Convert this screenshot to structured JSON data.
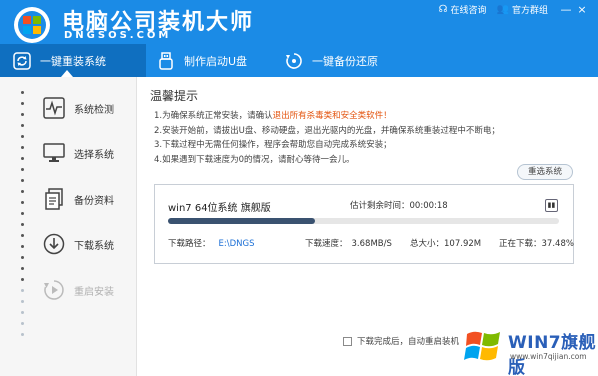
{
  "brand": {
    "title": "电脑公司装机大师",
    "subtitle": "DNGSOS.COM"
  },
  "top_links": {
    "consult": "在线咨询",
    "official_group": "官方群组",
    "minimize": "—",
    "close": "×"
  },
  "tabs": [
    {
      "label": "一键重装系统",
      "icon": "refresh-icon",
      "active": true
    },
    {
      "label": "制作启动U盘",
      "icon": "usb-icon",
      "active": false
    },
    {
      "label": "一键备份还原",
      "icon": "restore-icon",
      "active": false
    }
  ],
  "sidebar": {
    "items": [
      {
        "label": "系统检测",
        "icon": "pulse-icon",
        "enabled": true
      },
      {
        "label": "选择系统",
        "icon": "monitor-icon",
        "enabled": true
      },
      {
        "label": "备份资料",
        "icon": "documents-icon",
        "enabled": true
      },
      {
        "label": "下载系统",
        "icon": "download-icon",
        "enabled": true
      },
      {
        "label": "重启安装",
        "icon": "reboot-icon",
        "enabled": false
      }
    ]
  },
  "notice": {
    "title": "温馨提示",
    "tips": [
      {
        "prefix": "1.为确保系统正常安装，请确认",
        "warn": "退出所有杀毒类和安全类软件！",
        "suffix": ""
      },
      {
        "prefix": "2.安装开始前，请拔出U盘、移动硬盘，退出光驱内的光盘，并确保系统重装过程中不断电；",
        "warn": "",
        "suffix": ""
      },
      {
        "prefix": "3.下载过程中无需任何操作，程序会帮助您自动完成系统安装；",
        "warn": "",
        "suffix": ""
      },
      {
        "prefix": "4.如果遇到下载速度为0的情况，请耐心等待一会儿。",
        "warn": "",
        "suffix": ""
      }
    ]
  },
  "reselect_button": "重选系统",
  "download": {
    "system_name": "win7 64位系统 旗舰版",
    "remaining_label": "估计剩余时间：",
    "remaining_value": "00:00:18",
    "pause_icon": "pause-icon",
    "progress": 0.3748,
    "path_label": "下载路径：",
    "path_value": "E:\\DNGS",
    "speed_label": "下载速度：",
    "speed_value": "3.68MB/S",
    "size_label": "总大小：",
    "size_value": "107.92M",
    "status_label": "正在下载：",
    "status_value": "37.48%"
  },
  "reboot_option": {
    "label": "下载完成后，自动重启装机",
    "checked": false
  },
  "watermark": {
    "title": "WIN7旗舰版",
    "url": "www.win7qijian.com"
  },
  "colors": {
    "header_blue": "#1b8be6",
    "tab_active": "#0f6fc0",
    "warn_orange": "#e3530d",
    "progress_fill": "#3a5270",
    "path_blue": "#1b6fd6"
  }
}
